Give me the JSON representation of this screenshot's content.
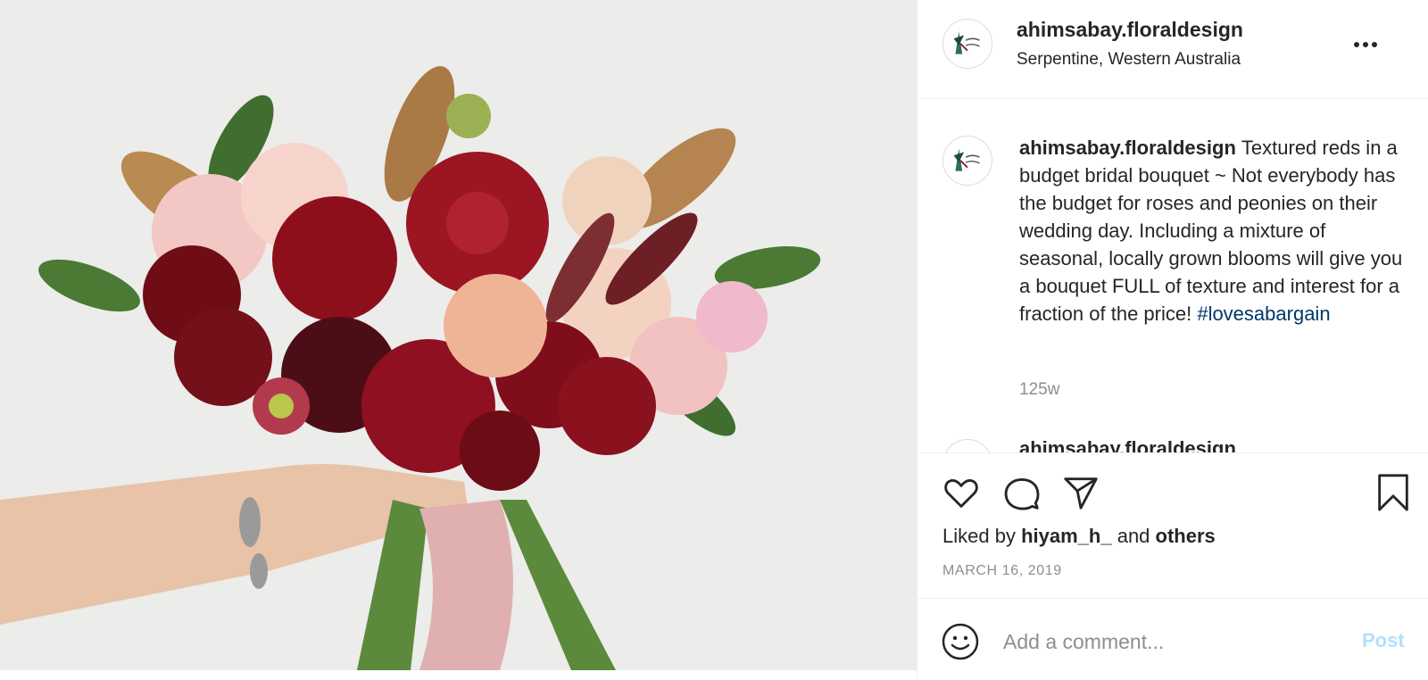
{
  "post": {
    "username": "ahimsabay.floraldesign",
    "location": "Serpentine, Western Australia",
    "avatar_logo_text": "ahimsa bay"
  },
  "caption": {
    "username": "ahimsabay.floraldesign",
    "text": "Textured reds in a budget bridal bouquet ~ Not everybody has the budget for roses and peonies on their wedding day. Including a mixture of seasonal, locally grown blooms will give you a bouquet FULL of texture and interest for a fraction of the price! ",
    "hashtag": "#lovesabargain",
    "time_ago": "125w",
    "next_comment_partial": "ahimsabay.floraldesign"
  },
  "actions": {
    "icons": [
      "heart-icon",
      "comment-icon",
      "share-icon",
      "bookmark-icon"
    ],
    "liked_by_prefix": "Liked by",
    "liked_by_user": "hiyam_h_",
    "liked_by_joiner": "and",
    "liked_by_others": "others",
    "date": "MARCH 16, 2019"
  },
  "add_comment": {
    "placeholder": "Add a comment...",
    "post_label": "Post"
  },
  "colors": {
    "link": "#00376b",
    "muted": "#8e8e8e",
    "post_disabled": "#b2dffc",
    "text": "#262626"
  }
}
